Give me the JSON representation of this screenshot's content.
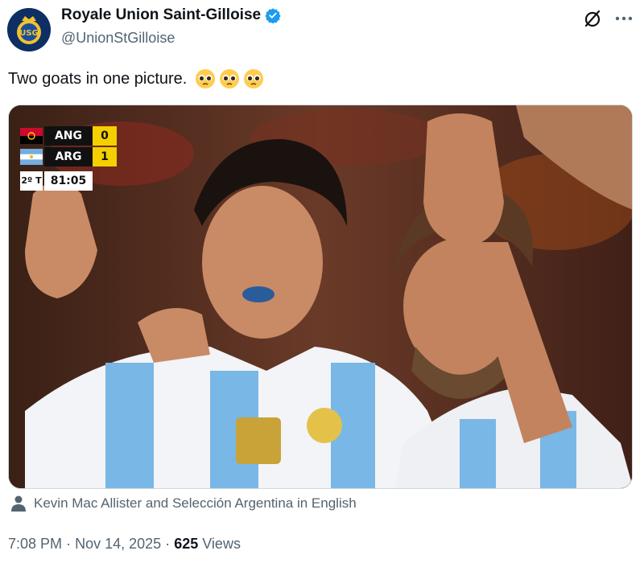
{
  "account": {
    "display_name": "Royale Union Saint-Gilloise",
    "handle": "@UnionStGilloise",
    "verified_color": "#1d9bf0",
    "avatar_icon": "club-crest-icon"
  },
  "header_actions": {
    "grok_icon": "slashed-circle-icon",
    "more_icon": "more-dots-icon"
  },
  "tweet": {
    "text": "Two goats in one picture.",
    "emojis": [
      "pleading-face-icon",
      "pleading-face-icon",
      "pleading-face-icon"
    ]
  },
  "scoreboard": {
    "home_team": "ANG",
    "home_score": "0",
    "away_team": "ARG",
    "away_score": "1",
    "half": "2º T",
    "clock": "81:05"
  },
  "tagged": {
    "icon": "person-icon",
    "text": "Kevin Mac Allister and Selección Argentina in English"
  },
  "meta": {
    "time": "7:08 PM",
    "date": "Nov 14, 2025",
    "separator": "·",
    "views_count": "625",
    "views_label": "Views"
  }
}
